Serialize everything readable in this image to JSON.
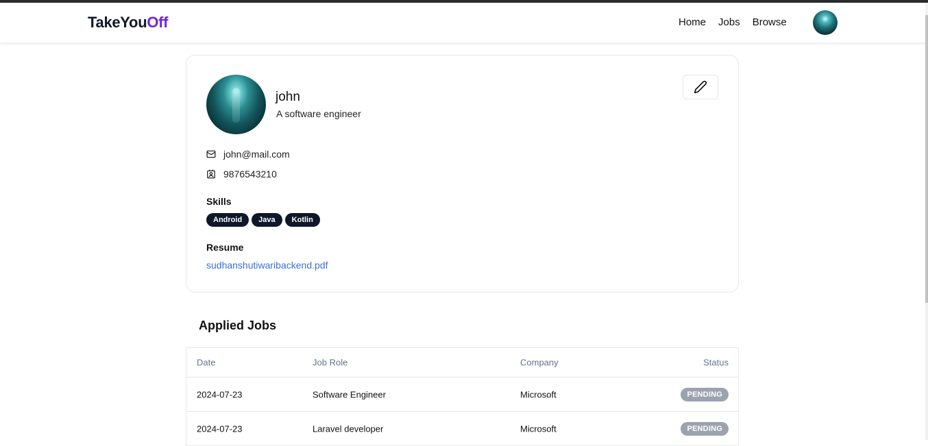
{
  "navbar": {
    "brand_part1": "TakeYou",
    "brand_part2": "Off",
    "links": [
      "Home",
      "Jobs",
      "Browse"
    ]
  },
  "profile": {
    "name": "john",
    "bio": "A software engineer",
    "email": "john@mail.com",
    "phone": "9876543210",
    "skills_label": "Skills",
    "skills": [
      "Android",
      "Java",
      "Kotlin"
    ],
    "resume_label": "Resume",
    "resume_file": "sudhanshutiwaribackend.pdf"
  },
  "applied_jobs": {
    "title": "Applied Jobs",
    "columns": [
      "Date",
      "Job Role",
      "Company",
      "Status"
    ],
    "rows": [
      {
        "date": "2024-07-23",
        "role": "Software Engineer",
        "company": "Microsoft",
        "status": "PENDING"
      },
      {
        "date": "2024-07-23",
        "role": "Laravel developer",
        "company": "Microsoft",
        "status": "PENDING"
      }
    ]
  },
  "colors": {
    "brand_accent": "#6d28d9",
    "skill_badge": "#0f172a",
    "status_pending": "#9ca3af",
    "link": "#3b6fd8"
  },
  "icons": {
    "edit": "pencil-icon",
    "email": "mail-icon",
    "phone": "contact-card-icon"
  }
}
